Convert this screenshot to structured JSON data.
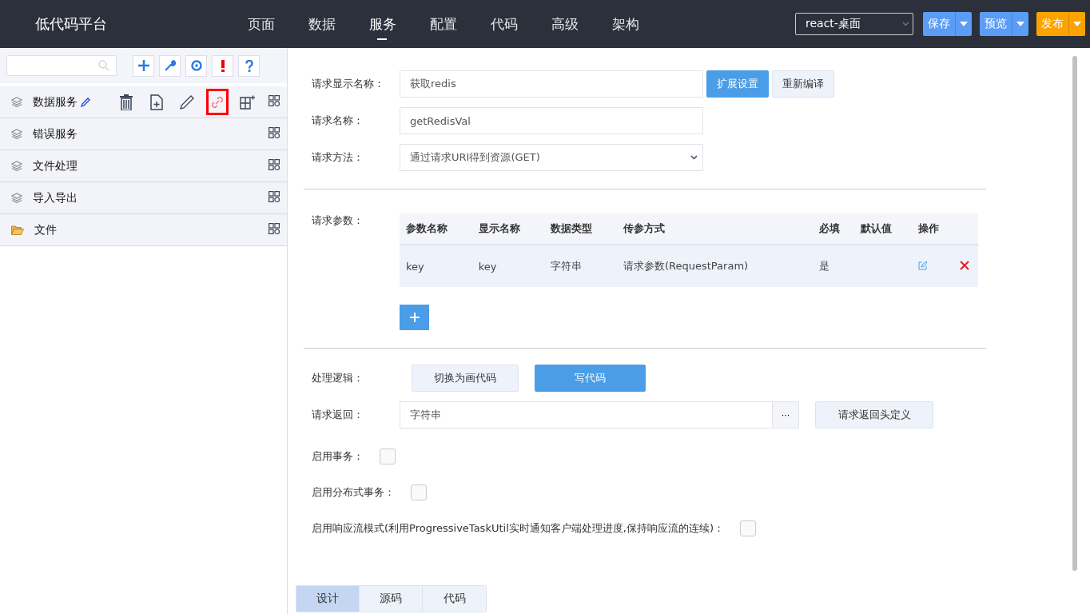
{
  "header": {
    "logo": "低代码平台",
    "nav": [
      {
        "label": "页面",
        "selected": false
      },
      {
        "label": "数据",
        "selected": false
      },
      {
        "label": "服务",
        "selected": true
      },
      {
        "label": "配置",
        "selected": false
      },
      {
        "label": "代码",
        "selected": false
      },
      {
        "label": "高级",
        "selected": false
      },
      {
        "label": "架构",
        "selected": false
      }
    ],
    "project": "react-桌面",
    "buttons": [
      {
        "label": "保存",
        "kind": "blue"
      },
      {
        "label": "预览",
        "kind": "blue"
      },
      {
        "label": "发布",
        "kind": "orange"
      }
    ]
  },
  "sidebar": {
    "tools": [
      {
        "kind": "add"
      },
      {
        "kind": "wrench"
      },
      {
        "kind": "target"
      },
      {
        "kind": "alert"
      },
      {
        "kind": "help"
      }
    ],
    "items": [
      {
        "label": "数据服务",
        "kind": "layers",
        "hovered": true,
        "actions": [
          {
            "kind": "delete",
            "highlighted": false
          },
          {
            "kind": "new-file",
            "highlighted": false
          },
          {
            "kind": "edit",
            "highlighted": false
          },
          {
            "kind": "link",
            "highlighted": true
          },
          {
            "kind": "add-grid",
            "highlighted": false
          }
        ]
      },
      {
        "label": "错误服务",
        "kind": "layers",
        "hovered": false
      },
      {
        "label": "文件处理",
        "kind": "layers",
        "hovered": false
      },
      {
        "label": "导入导出",
        "kind": "layers",
        "hovered": false
      },
      {
        "label": "文件",
        "kind": "folder",
        "hovered": false
      }
    ]
  },
  "form": {
    "display_name": {
      "label": "请求显示名称：",
      "value": "获取redis",
      "buttons": [
        {
          "label": "扩展设置",
          "kind": "primary"
        },
        {
          "label": "重新编译",
          "kind": "default"
        }
      ]
    },
    "request_name": {
      "label": "请求名称：",
      "value": "getRedisVal"
    },
    "method": {
      "label": "请求方法：",
      "value": "通过请求URI得到资源(GET)"
    },
    "params": {
      "label": "请求参数：",
      "columns": [
        "参数名称",
        "显示名称",
        "数据类型",
        "传参方式",
        "必填",
        "默认值",
        "操作"
      ],
      "rows": [
        {
          "cells": [
            "key",
            "key",
            "字符串",
            "请求参数(RequestParam)",
            "是",
            ""
          ]
        }
      ]
    },
    "logic": {
      "label": "处理逻辑：",
      "options": [
        {
          "label": "切换为画代码",
          "selected": false
        },
        {
          "label": "写代码",
          "selected": true
        }
      ]
    },
    "returns": {
      "label": "请求返回：",
      "value": "字符串",
      "more": "···",
      "button": "请求返回头定义"
    },
    "checks": [
      {
        "label": "启用事务：",
        "checked": false
      },
      {
        "label": "启用分布式事务：",
        "checked": false
      },
      {
        "label": "启用响应流模式(利用ProgressiveTaskUtil实时通知客户端处理进度,保持响应流的连续)：",
        "checked": false
      }
    ]
  },
  "bottom_tabs": [
    {
      "label": "设计",
      "selected": true
    },
    {
      "label": "源码",
      "selected": false
    },
    {
      "label": "代码",
      "selected": false
    }
  ]
}
